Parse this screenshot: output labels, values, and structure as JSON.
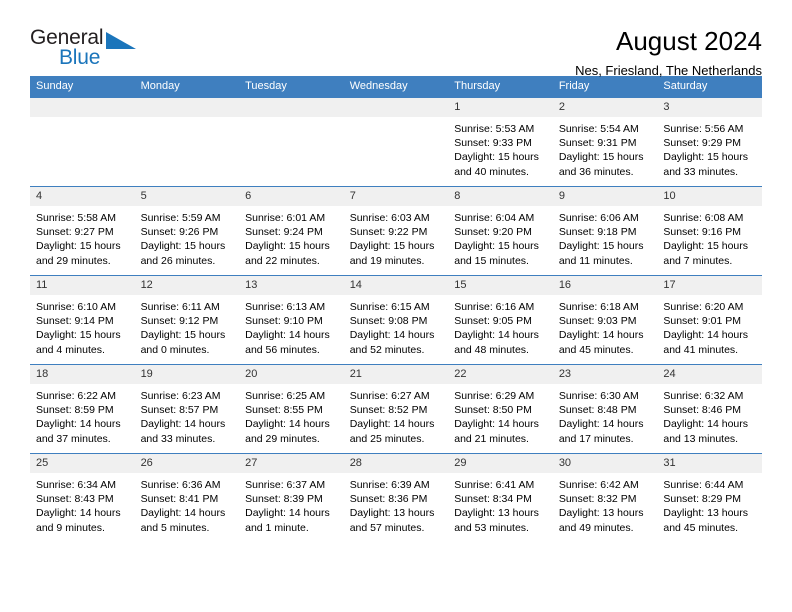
{
  "brand": {
    "name_part1": "General",
    "name_part2": "Blue",
    "flag_icon": "triangle-flag-icon",
    "accent_color": "#1b75bb"
  },
  "header": {
    "title": "August 2024",
    "subtitle": "Nes, Friesland, The Netherlands"
  },
  "calendar": {
    "header_bg": "#3f7fbf",
    "daynum_bg": "#f0f0f0",
    "weekday_headers": [
      "Sunday",
      "Monday",
      "Tuesday",
      "Wednesday",
      "Thursday",
      "Friday",
      "Saturday"
    ],
    "weeks": [
      [
        {
          "day": "",
          "lines": []
        },
        {
          "day": "",
          "lines": []
        },
        {
          "day": "",
          "lines": []
        },
        {
          "day": "",
          "lines": []
        },
        {
          "day": "1",
          "lines": [
            "Sunrise: 5:53 AM",
            "Sunset: 9:33 PM",
            "Daylight: 15 hours",
            "and 40 minutes."
          ]
        },
        {
          "day": "2",
          "lines": [
            "Sunrise: 5:54 AM",
            "Sunset: 9:31 PM",
            "Daylight: 15 hours",
            "and 36 minutes."
          ]
        },
        {
          "day": "3",
          "lines": [
            "Sunrise: 5:56 AM",
            "Sunset: 9:29 PM",
            "Daylight: 15 hours",
            "and 33 minutes."
          ]
        }
      ],
      [
        {
          "day": "4",
          "lines": [
            "Sunrise: 5:58 AM",
            "Sunset: 9:27 PM",
            "Daylight: 15 hours",
            "and 29 minutes."
          ]
        },
        {
          "day": "5",
          "lines": [
            "Sunrise: 5:59 AM",
            "Sunset: 9:26 PM",
            "Daylight: 15 hours",
            "and 26 minutes."
          ]
        },
        {
          "day": "6",
          "lines": [
            "Sunrise: 6:01 AM",
            "Sunset: 9:24 PM",
            "Daylight: 15 hours",
            "and 22 minutes."
          ]
        },
        {
          "day": "7",
          "lines": [
            "Sunrise: 6:03 AM",
            "Sunset: 9:22 PM",
            "Daylight: 15 hours",
            "and 19 minutes."
          ]
        },
        {
          "day": "8",
          "lines": [
            "Sunrise: 6:04 AM",
            "Sunset: 9:20 PM",
            "Daylight: 15 hours",
            "and 15 minutes."
          ]
        },
        {
          "day": "9",
          "lines": [
            "Sunrise: 6:06 AM",
            "Sunset: 9:18 PM",
            "Daylight: 15 hours",
            "and 11 minutes."
          ]
        },
        {
          "day": "10",
          "lines": [
            "Sunrise: 6:08 AM",
            "Sunset: 9:16 PM",
            "Daylight: 15 hours",
            "and 7 minutes."
          ]
        }
      ],
      [
        {
          "day": "11",
          "lines": [
            "Sunrise: 6:10 AM",
            "Sunset: 9:14 PM",
            "Daylight: 15 hours",
            "and 4 minutes."
          ]
        },
        {
          "day": "12",
          "lines": [
            "Sunrise: 6:11 AM",
            "Sunset: 9:12 PM",
            "Daylight: 15 hours",
            "and 0 minutes."
          ]
        },
        {
          "day": "13",
          "lines": [
            "Sunrise: 6:13 AM",
            "Sunset: 9:10 PM",
            "Daylight: 14 hours",
            "and 56 minutes."
          ]
        },
        {
          "day": "14",
          "lines": [
            "Sunrise: 6:15 AM",
            "Sunset: 9:08 PM",
            "Daylight: 14 hours",
            "and 52 minutes."
          ]
        },
        {
          "day": "15",
          "lines": [
            "Sunrise: 6:16 AM",
            "Sunset: 9:05 PM",
            "Daylight: 14 hours",
            "and 48 minutes."
          ]
        },
        {
          "day": "16",
          "lines": [
            "Sunrise: 6:18 AM",
            "Sunset: 9:03 PM",
            "Daylight: 14 hours",
            "and 45 minutes."
          ]
        },
        {
          "day": "17",
          "lines": [
            "Sunrise: 6:20 AM",
            "Sunset: 9:01 PM",
            "Daylight: 14 hours",
            "and 41 minutes."
          ]
        }
      ],
      [
        {
          "day": "18",
          "lines": [
            "Sunrise: 6:22 AM",
            "Sunset: 8:59 PM",
            "Daylight: 14 hours",
            "and 37 minutes."
          ]
        },
        {
          "day": "19",
          "lines": [
            "Sunrise: 6:23 AM",
            "Sunset: 8:57 PM",
            "Daylight: 14 hours",
            "and 33 minutes."
          ]
        },
        {
          "day": "20",
          "lines": [
            "Sunrise: 6:25 AM",
            "Sunset: 8:55 PM",
            "Daylight: 14 hours",
            "and 29 minutes."
          ]
        },
        {
          "day": "21",
          "lines": [
            "Sunrise: 6:27 AM",
            "Sunset: 8:52 PM",
            "Daylight: 14 hours",
            "and 25 minutes."
          ]
        },
        {
          "day": "22",
          "lines": [
            "Sunrise: 6:29 AM",
            "Sunset: 8:50 PM",
            "Daylight: 14 hours",
            "and 21 minutes."
          ]
        },
        {
          "day": "23",
          "lines": [
            "Sunrise: 6:30 AM",
            "Sunset: 8:48 PM",
            "Daylight: 14 hours",
            "and 17 minutes."
          ]
        },
        {
          "day": "24",
          "lines": [
            "Sunrise: 6:32 AM",
            "Sunset: 8:46 PM",
            "Daylight: 14 hours",
            "and 13 minutes."
          ]
        }
      ],
      [
        {
          "day": "25",
          "lines": [
            "Sunrise: 6:34 AM",
            "Sunset: 8:43 PM",
            "Daylight: 14 hours",
            "and 9 minutes."
          ]
        },
        {
          "day": "26",
          "lines": [
            "Sunrise: 6:36 AM",
            "Sunset: 8:41 PM",
            "Daylight: 14 hours",
            "and 5 minutes."
          ]
        },
        {
          "day": "27",
          "lines": [
            "Sunrise: 6:37 AM",
            "Sunset: 8:39 PM",
            "Daylight: 14 hours",
            "and 1 minute."
          ]
        },
        {
          "day": "28",
          "lines": [
            "Sunrise: 6:39 AM",
            "Sunset: 8:36 PM",
            "Daylight: 13 hours",
            "and 57 minutes."
          ]
        },
        {
          "day": "29",
          "lines": [
            "Sunrise: 6:41 AM",
            "Sunset: 8:34 PM",
            "Daylight: 13 hours",
            "and 53 minutes."
          ]
        },
        {
          "day": "30",
          "lines": [
            "Sunrise: 6:42 AM",
            "Sunset: 8:32 PM",
            "Daylight: 13 hours",
            "and 49 minutes."
          ]
        },
        {
          "day": "31",
          "lines": [
            "Sunrise: 6:44 AM",
            "Sunset: 8:29 PM",
            "Daylight: 13 hours",
            "and 45 minutes."
          ]
        }
      ]
    ]
  }
}
